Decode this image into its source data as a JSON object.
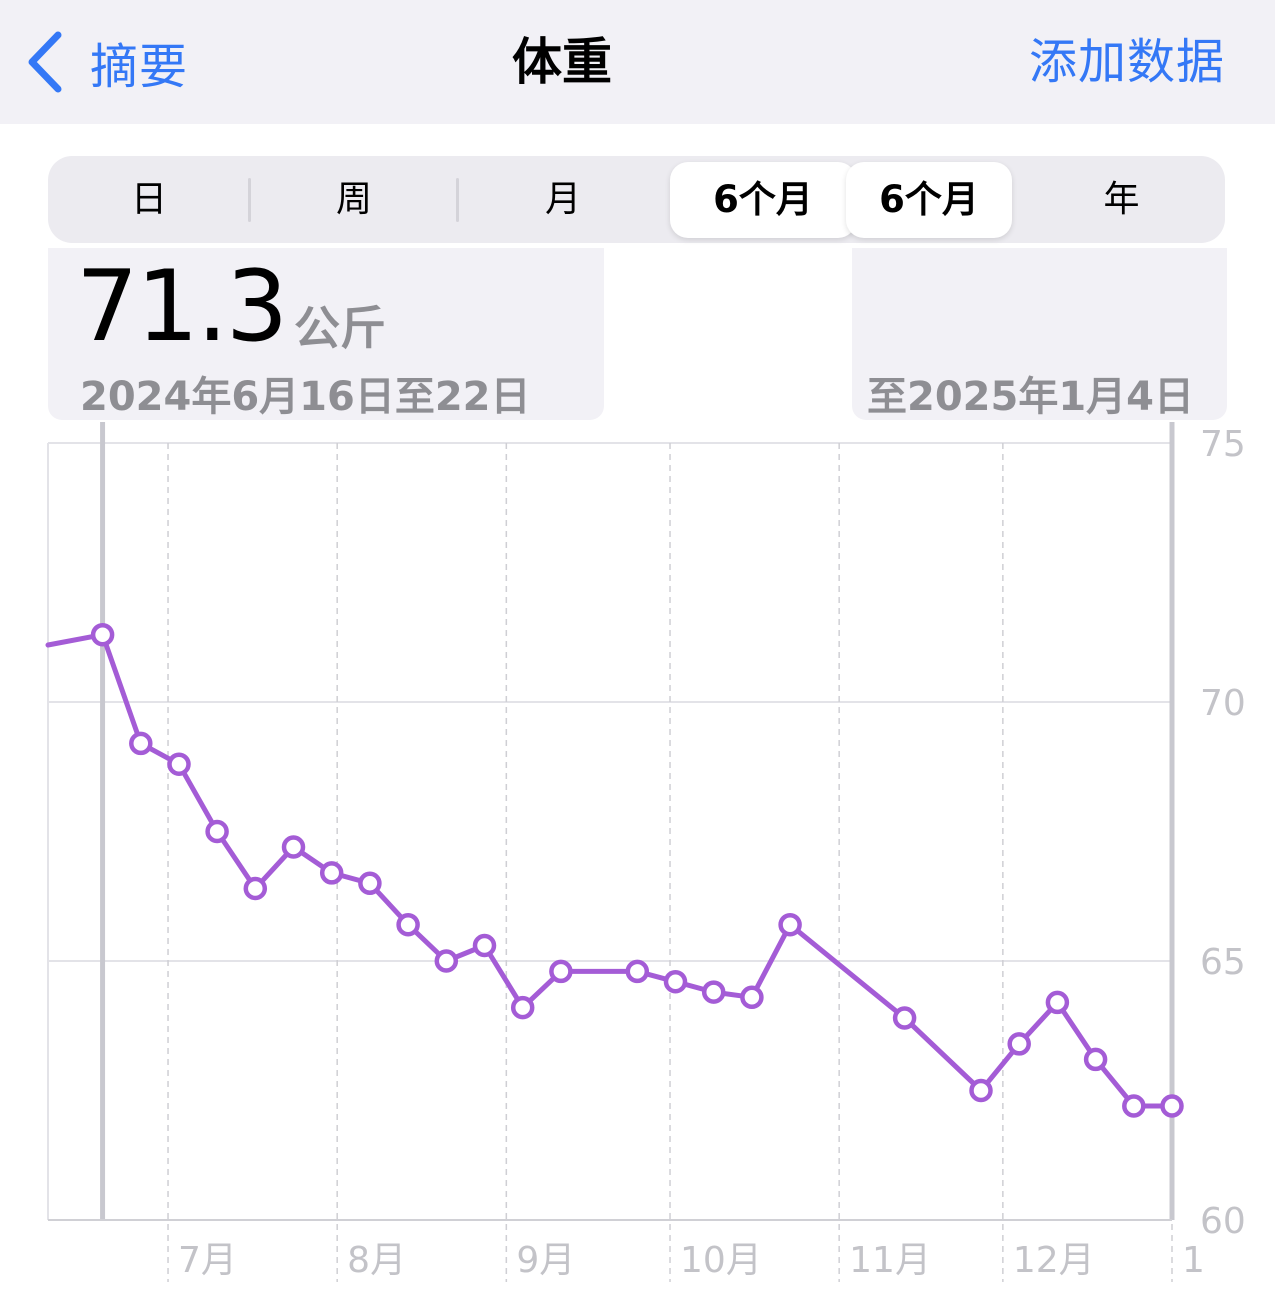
{
  "nav": {
    "back_label": "摘要",
    "title": "体重",
    "action_label": "添加数据"
  },
  "segments": {
    "day": "日",
    "week": "周",
    "month": "月",
    "six_months_a": "6个月",
    "six_months_b": "6个月",
    "year": "年"
  },
  "summary": {
    "value": "71.3",
    "unit": "公斤",
    "date_range_start": "2024年6月16日至22日",
    "date_range_end": "至2025年1月4日"
  },
  "colors": {
    "accent_blue": "#3478f6",
    "series_purple": "#a45cd6"
  },
  "chart_data": {
    "type": "line",
    "ylim": [
      60,
      75
    ],
    "y_ticks": [
      "75",
      "70",
      "65",
      "60"
    ],
    "x_tick_labels": [
      "7月",
      "8月",
      "9月",
      "10月",
      "11月",
      "12月",
      "1"
    ],
    "grid": true,
    "series": [
      {
        "points": [
          [
            "2024-06-19",
            71.3
          ],
          [
            "2024-06-26",
            69.2
          ],
          [
            "2024-07-03",
            68.8
          ],
          [
            "2024-07-10",
            67.5
          ],
          [
            "2024-07-17",
            66.4
          ],
          [
            "2024-07-24",
            67.2
          ],
          [
            "2024-07-31",
            66.7
          ],
          [
            "2024-08-07",
            66.5
          ],
          [
            "2024-08-14",
            65.7
          ],
          [
            "2024-08-21",
            65.0
          ],
          [
            "2024-08-28",
            65.3
          ],
          [
            "2024-09-04",
            64.1
          ],
          [
            "2024-09-11",
            64.8
          ],
          [
            "2024-09-25",
            64.8
          ],
          [
            "2024-10-02",
            64.6
          ],
          [
            "2024-10-09",
            64.4
          ],
          [
            "2024-10-16",
            64.3
          ],
          [
            "2024-10-23",
            65.7
          ],
          [
            "2024-11-13",
            63.9
          ],
          [
            "2024-11-27",
            62.5
          ],
          [
            "2024-12-04",
            63.4
          ],
          [
            "2024-12-11",
            64.2
          ],
          [
            "2024-12-18",
            63.1
          ],
          [
            "2024-12-25",
            62.2
          ],
          [
            "2025-01-01",
            62.2
          ]
        ]
      }
    ]
  }
}
